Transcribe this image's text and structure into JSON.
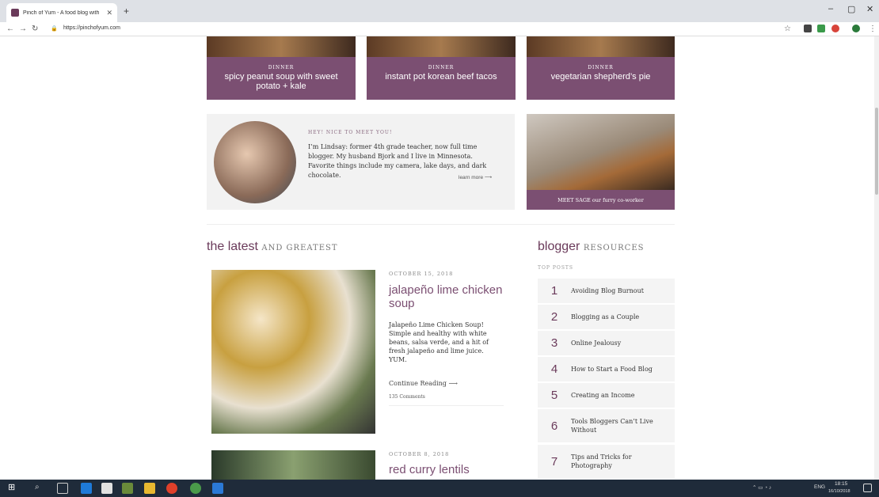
{
  "browser": {
    "tab_title": "Pinch of Yum - A food blog with",
    "url": "https://pinchofyum.com",
    "minimize": "–",
    "maximize": "▢",
    "close": "✕"
  },
  "cards": [
    {
      "category": "DINNER",
      "name": "spicy peanut soup with sweet potato + kale"
    },
    {
      "category": "DINNER",
      "name": "instant pot korean beef tacos"
    },
    {
      "category": "DINNER",
      "name": "vegetarian shepherd’s pie"
    }
  ],
  "about": {
    "greeting": "HEY! NICE TO MEET YOU!",
    "bio": "I’m Lindsay: former 4th grade teacher, now full time blogger. My husband Bjork and I live in Minnesota. Favorite things include my camera, lake days, and dark chocolate.",
    "learn_more": "learn more ⟶"
  },
  "sage": {
    "label": "MEET SAGE our furry co-worker"
  },
  "latest": {
    "title": "the latest",
    "subtitle": "AND GREATEST"
  },
  "posts": [
    {
      "date": "OCTOBER 15, 2018",
      "title": "jalapeño lime chicken soup",
      "excerpt": "Jalapeño Lime Chicken Soup! Simple and healthy with white beans, salsa verde, and a hit of fresh jalapeño and lime juice. YUM.",
      "continue": "Continue Reading ⟶",
      "comments": "135 Comments"
    },
    {
      "date": "OCTOBER 8, 2018",
      "title": "red curry lentils"
    }
  ],
  "resources": {
    "title": "blogger",
    "subtitle": "RESOURCES",
    "top_label": "TOP POSTS",
    "items": [
      {
        "num": "1",
        "title": "Avoiding Blog Burnout"
      },
      {
        "num": "2",
        "title": "Blogging as a Couple"
      },
      {
        "num": "3",
        "title": "Online Jealousy"
      },
      {
        "num": "4",
        "title": "How to Start a Food Blog"
      },
      {
        "num": "5",
        "title": "Creating an Income"
      },
      {
        "num": "6",
        "title": "Tools Bloggers Can’t Live Without"
      },
      {
        "num": "7",
        "title": "Tips and Tricks for Photography"
      }
    ]
  },
  "taskbar": {
    "lang": "ENG",
    "time": "18:15",
    "date": "16/10/2018"
  }
}
